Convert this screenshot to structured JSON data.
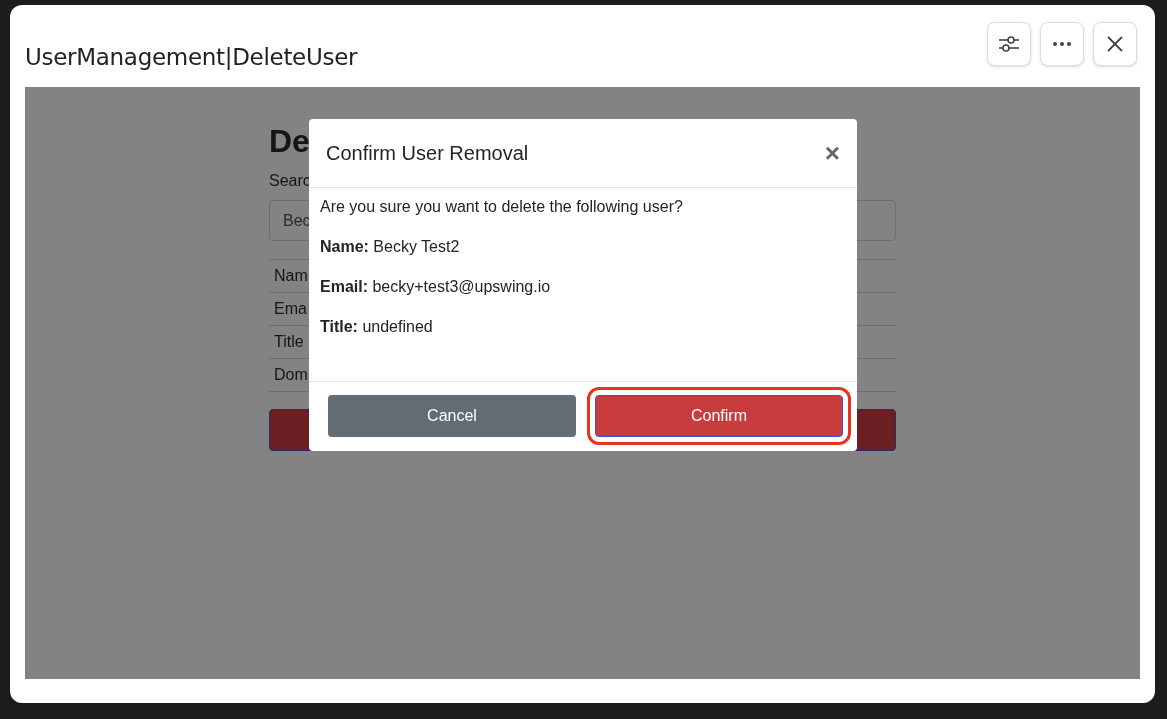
{
  "window": {
    "title": "UserManagement|DeleteUser"
  },
  "background_page": {
    "heading": "De",
    "search_label": "Searc",
    "search_value": "Bec",
    "rows": [
      "Nam",
      "Ema",
      "Title",
      "Dom"
    ]
  },
  "dialog": {
    "title": "Confirm User Removal",
    "close": "×",
    "question": "Are you sure you want to delete the following user?",
    "details": [
      "**Name:** Becky Test2",
      "**Email:** becky+test3@upswing.io",
      "**Title:** undefined"
    ],
    "buttons": [
      {
        "label": "Cancel",
        "kind": "secondary",
        "highlighted": false
      },
      {
        "label": "Confirm",
        "kind": "danger",
        "highlighted": true
      }
    ]
  }
}
